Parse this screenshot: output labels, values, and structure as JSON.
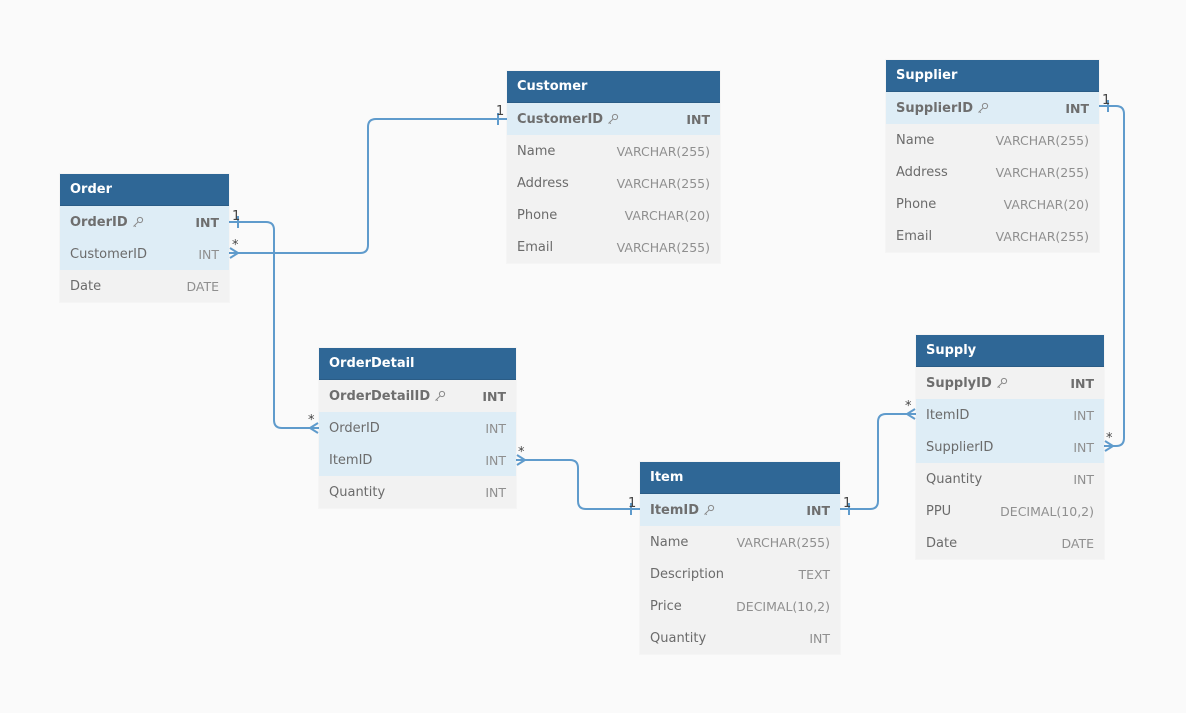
{
  "colors": {
    "background": "#fafafa",
    "header": "#2f6796",
    "header_text": "#ffffff",
    "row": "#f2f2f2",
    "row_highlight": "#deedf6",
    "link": "#5f9bcc"
  },
  "tables": {
    "order": {
      "title": "Order",
      "columns": [
        {
          "name": "OrderID",
          "type": "INT",
          "pk": true
        },
        {
          "name": "CustomerID",
          "type": "INT"
        },
        {
          "name": "Date",
          "type": "DATE"
        }
      ]
    },
    "customer": {
      "title": "Customer",
      "columns": [
        {
          "name": "CustomerID",
          "type": "INT",
          "pk": true
        },
        {
          "name": "Name",
          "type": "VARCHAR(255)"
        },
        {
          "name": "Address",
          "type": "VARCHAR(255)"
        },
        {
          "name": "Phone",
          "type": "VARCHAR(20)"
        },
        {
          "name": "Email",
          "type": "VARCHAR(255)"
        }
      ]
    },
    "supplier": {
      "title": "Supplier",
      "columns": [
        {
          "name": "SupplierID",
          "type": "INT",
          "pk": true
        },
        {
          "name": "Name",
          "type": "VARCHAR(255)"
        },
        {
          "name": "Address",
          "type": "VARCHAR(255)"
        },
        {
          "name": "Phone",
          "type": "VARCHAR(20)"
        },
        {
          "name": "Email",
          "type": "VARCHAR(255)"
        }
      ]
    },
    "orderdetail": {
      "title": "OrderDetail",
      "columns": [
        {
          "name": "OrderDetailID",
          "type": "INT",
          "pk": true
        },
        {
          "name": "OrderID",
          "type": "INT"
        },
        {
          "name": "ItemID",
          "type": "INT"
        },
        {
          "name": "Quantity",
          "type": "INT"
        }
      ]
    },
    "item": {
      "title": "Item",
      "columns": [
        {
          "name": "ItemID",
          "type": "INT",
          "pk": true
        },
        {
          "name": "Name",
          "type": "VARCHAR(255)"
        },
        {
          "name": "Description",
          "type": "TEXT"
        },
        {
          "name": "Price",
          "type": "DECIMAL(10,2)"
        },
        {
          "name": "Quantity",
          "type": "INT"
        }
      ]
    },
    "supply": {
      "title": "Supply",
      "columns": [
        {
          "name": "SupplyID",
          "type": "INT",
          "pk": true
        },
        {
          "name": "ItemID",
          "type": "INT"
        },
        {
          "name": "SupplierID",
          "type": "INT"
        },
        {
          "name": "Quantity",
          "type": "INT"
        },
        {
          "name": "PPU",
          "type": "DECIMAL(10,2)"
        },
        {
          "name": "Date",
          "type": "DATE"
        }
      ]
    }
  },
  "relationships": [
    {
      "from": "Order.CustomerID",
      "to": "Customer.CustomerID",
      "from_card": "*",
      "to_card": "1"
    },
    {
      "from": "OrderDetail.OrderID",
      "to": "Order.OrderID",
      "from_card": "*",
      "to_card": "1"
    },
    {
      "from": "OrderDetail.ItemID",
      "to": "Item.ItemID",
      "from_card": "*",
      "to_card": "1"
    },
    {
      "from": "Supply.ItemID",
      "to": "Item.ItemID",
      "from_card": "*",
      "to_card": "1"
    },
    {
      "from": "Supply.SupplierID",
      "to": "Supplier.SupplierID",
      "from_card": "*",
      "to_card": "1"
    }
  ]
}
